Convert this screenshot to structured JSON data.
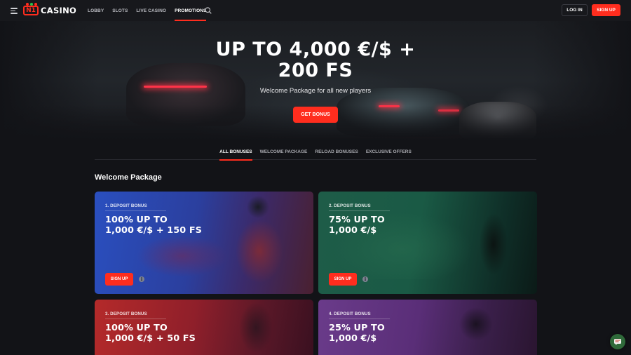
{
  "header": {
    "logo_text": "CASINO",
    "logo_badge": "N1",
    "nav": [
      "LOBBY",
      "SLOTS",
      "LIVE CASINO",
      "PROMOTIONS"
    ],
    "active_nav": "PROMOTIONS",
    "login_label": "LOG IN",
    "signup_label": "SIGN UP"
  },
  "hero": {
    "title_line1": "UP TO 4,000 €/$ +",
    "title_line2": "200 FS",
    "subtitle": "Welcome Package for all new players",
    "button_label": "GET BONUS"
  },
  "tabs": [
    "ALL BONUSES",
    "WELCOME PACKAGE",
    "RELOAD BONUSES",
    "EXCLUSIVE OFFERS"
  ],
  "section_title": "Welcome Package",
  "cards": [
    {
      "label": "1. DEPOSIT BONUS",
      "title_line1": "100% UP TO",
      "title_line2": "1,000 €/$ + 150 FS",
      "button_label": "SIGN UP",
      "info": "i"
    },
    {
      "label": "2. DEPOSIT BONUS",
      "title_line1": "75% UP TO",
      "title_line2": "1,000 €/$",
      "button_label": "SIGN UP",
      "info": "i"
    },
    {
      "label": "3. DEPOSIT BONUS",
      "title_line1": "100% UP TO",
      "title_line2": "1,000 €/$ + 50 FS"
    },
    {
      "label": "4. DEPOSIT BONUS",
      "title_line1": "25% UP TO",
      "title_line2": "1,000 €/$"
    }
  ],
  "colors": {
    "accent": "#ff2d1e",
    "background": "#121317",
    "header": "#17181c"
  }
}
